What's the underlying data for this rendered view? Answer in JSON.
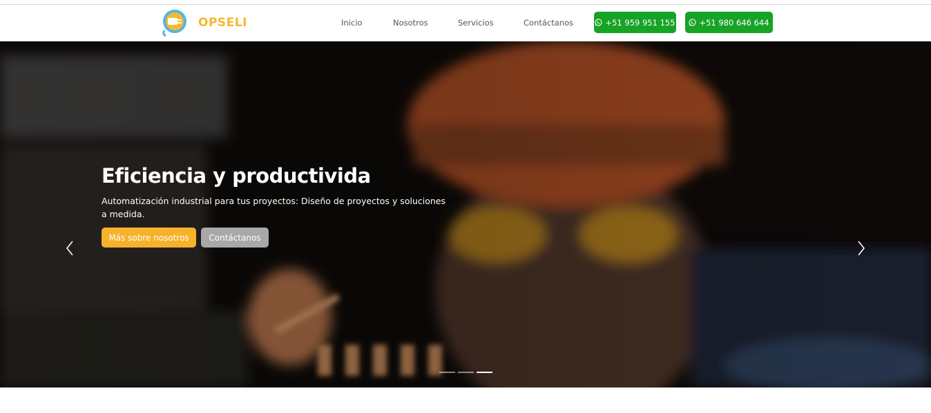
{
  "brand": {
    "name": "OPSELI",
    "logo_icon": "plug-bulb-logo-icon",
    "accent_color": "#f5b82e"
  },
  "nav": {
    "items": [
      {
        "label": "Inicio"
      },
      {
        "label": "Nosotros"
      },
      {
        "label": "Servicios"
      },
      {
        "label": "Contáctanos"
      }
    ],
    "whatsapp": [
      {
        "label": "+51 959 951 155",
        "icon": "whatsapp-icon",
        "color": "#17a326"
      },
      {
        "label": "+51 980 646 644",
        "icon": "whatsapp-icon",
        "color": "#17a326"
      }
    ]
  },
  "hero": {
    "title": "Eficiencia y productivida",
    "subtitle": "Automatización industrial para tus proyectos: Diseño de proyectos y soluciones a medida.",
    "primary_button": "Más sobre nosotros",
    "secondary_button": "Contáctanos",
    "prev_icon": "chevron-left-icon",
    "next_icon": "chevron-right-icon",
    "slides_total": 3,
    "active_slide": 3
  }
}
